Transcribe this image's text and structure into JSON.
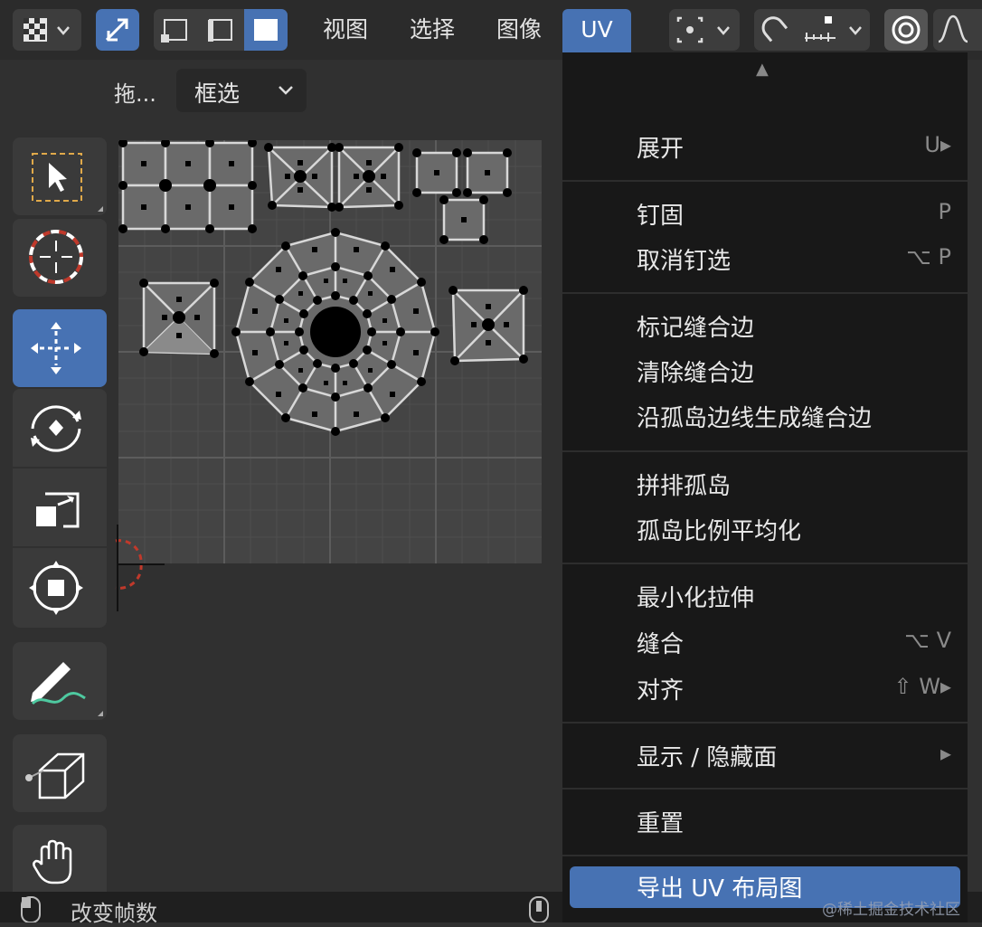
{
  "header": {
    "menus": [
      "视图",
      "选择",
      "图像",
      "UV"
    ],
    "active_menu": "UV"
  },
  "tool_settings": {
    "drag_label": "拖...",
    "select_mode": "框选"
  },
  "toolbar": {
    "tools": [
      {
        "name": "select-box-tool",
        "icon": "select-box-icon"
      },
      {
        "name": "cursor-tool",
        "icon": "cursor-icon"
      },
      {
        "name": "move-tool",
        "icon": "move-icon",
        "active": true
      },
      {
        "name": "rotate-tool",
        "icon": "rotate-icon"
      },
      {
        "name": "scale-tool",
        "icon": "scale-icon"
      },
      {
        "name": "transform-tool",
        "icon": "transform-icon"
      },
      {
        "name": "annotate-tool",
        "icon": "annotate-icon"
      },
      {
        "name": "rip-tool",
        "icon": "rip-icon"
      },
      {
        "name": "grab-tool",
        "icon": "grab-icon"
      }
    ]
  },
  "uv_menu": {
    "scroll_up_glyph": "▲",
    "items": [
      {
        "label": "展开",
        "shortcut": "U▸",
        "group": 0
      },
      {
        "label": "钉固",
        "shortcut": "P",
        "group": 1
      },
      {
        "label": "取消钉选",
        "shortcut": "⌥ P",
        "group": 1
      },
      {
        "label": "标记缝合边",
        "shortcut": "",
        "group": 2
      },
      {
        "label": "清除缝合边",
        "shortcut": "",
        "group": 2
      },
      {
        "label": "沿孤岛边线生成缝合边",
        "shortcut": "",
        "group": 2
      },
      {
        "label": "拼排孤岛",
        "shortcut": "",
        "group": 3
      },
      {
        "label": "孤岛比例平均化",
        "shortcut": "",
        "group": 3
      },
      {
        "label": "最小化拉伸",
        "shortcut": "",
        "group": 4
      },
      {
        "label": "缝合",
        "shortcut": "⌥ V",
        "group": 4
      },
      {
        "label": "对齐",
        "shortcut": "⇧ W▸",
        "group": 4
      },
      {
        "label": "显示 / 隐藏面",
        "shortcut": "▸",
        "group": 5
      },
      {
        "label": "重置",
        "shortcut": "",
        "group": 6
      },
      {
        "label": "导出 UV 布局图",
        "shortcut": "",
        "group": 7,
        "highlighted": true
      }
    ]
  },
  "footer": {
    "status_label": "改变帧数"
  },
  "watermark": "@稀土掘金技术社区",
  "colors": {
    "accent": "#4772b3",
    "menu_bg": "#181818",
    "panel_bg": "#303030",
    "uv_bg": "#444444"
  }
}
